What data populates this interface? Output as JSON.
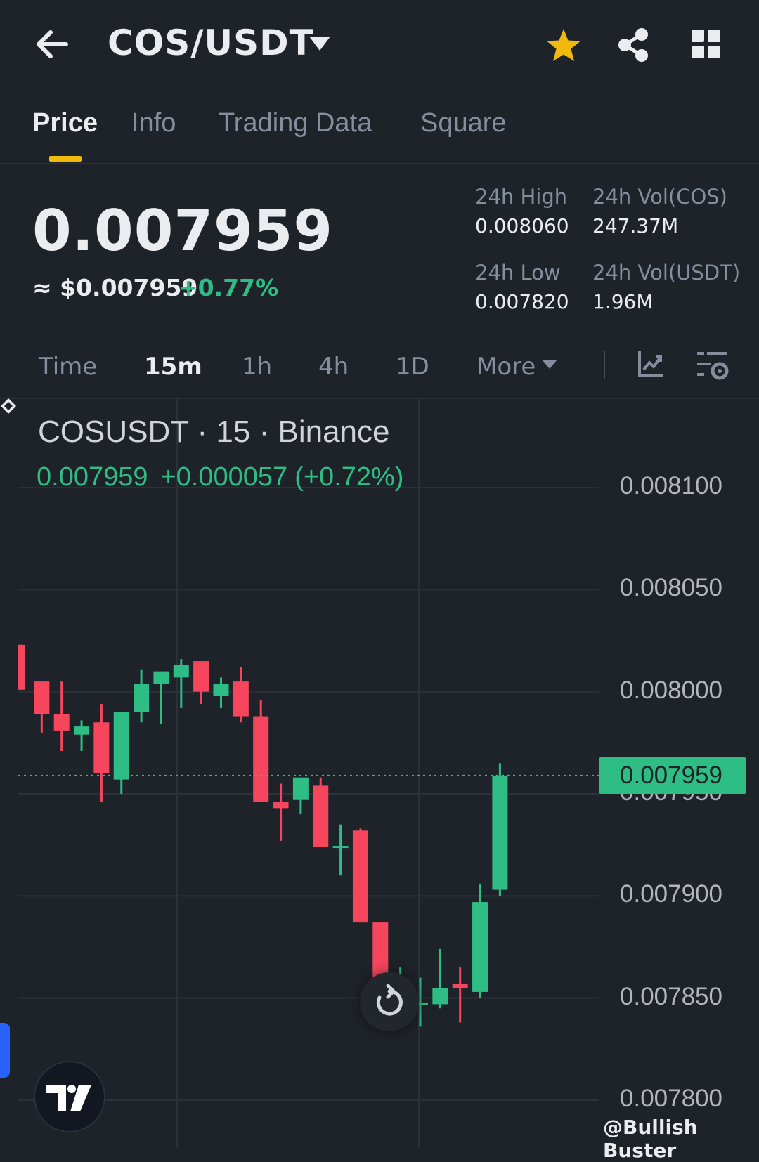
{
  "header": {
    "pair": "COS/USDT",
    "icons": [
      "back-arrow-icon",
      "chevron-down-icon",
      "star-icon",
      "share-icon",
      "grid-icon"
    ],
    "favorite_color": "#f0b90b"
  },
  "tabs": [
    {
      "label": "Price",
      "active": true
    },
    {
      "label": "Info",
      "active": false
    },
    {
      "label": "Trading Data",
      "active": false
    },
    {
      "label": "Square",
      "active": false
    }
  ],
  "ticker": {
    "price": "0.007959",
    "fiat": "≈ $0.007959",
    "change": "+0.77%",
    "high_label": "24h High",
    "high": "0.008060",
    "low_label": "24h Low",
    "low": "0.007820",
    "vol_base_label": "24h Vol(COS)",
    "vol_base": "247.37M",
    "vol_quote_label": "24h Vol(USDT)",
    "vol_quote": "1.96M"
  },
  "intervals": [
    {
      "label": "Time",
      "active": false
    },
    {
      "label": "15m",
      "active": true
    },
    {
      "label": "1h",
      "active": false
    },
    {
      "label": "4h",
      "active": false
    },
    {
      "label": "1D",
      "active": false
    },
    {
      "label": "More",
      "active": false
    }
  ],
  "chart_data": {
    "type": "candlestick",
    "symbol_line": "COSUSDT · 15 · Binance",
    "last": "0.007959",
    "change_abs": "+0.000057",
    "change_pct": "(+0.72%)",
    "y_ticks": [
      "0.008100",
      "0.008050",
      "0.008000",
      "0.007950",
      "0.007900",
      "0.007850",
      "0.007800"
    ],
    "ylim": [
      0.0078,
      0.0081
    ],
    "current_price": 0.007959,
    "current_price_label": "0.007959",
    "up_color": "#2ebd85",
    "down_color": "#f6465d",
    "candles": [
      {
        "o": 0.008023,
        "h": 0.008023,
        "l": 0.008001,
        "c": 0.008001
      },
      {
        "o": 0.008005,
        "h": 0.008005,
        "l": 0.00798,
        "c": 0.007989
      },
      {
        "o": 0.007989,
        "h": 0.008005,
        "l": 0.007971,
        "c": 0.007981
      },
      {
        "o": 0.007979,
        "h": 0.007986,
        "l": 0.007971,
        "c": 0.007983
      },
      {
        "o": 0.007985,
        "h": 0.007994,
        "l": 0.007946,
        "c": 0.00796
      },
      {
        "o": 0.007957,
        "h": 0.007989,
        "l": 0.00795,
        "c": 0.00799
      },
      {
        "o": 0.00799,
        "h": 0.008011,
        "l": 0.007985,
        "c": 0.008004
      },
      {
        "o": 0.008004,
        "h": 0.008007,
        "l": 0.007984,
        "c": 0.00801
      },
      {
        "o": 0.008007,
        "h": 0.008016,
        "l": 0.007992,
        "c": 0.008013
      },
      {
        "o": 0.008015,
        "h": 0.008015,
        "l": 0.007994,
        "c": 0.008
      },
      {
        "o": 0.007998,
        "h": 0.008007,
        "l": 0.007992,
        "c": 0.008004
      },
      {
        "o": 0.008005,
        "h": 0.008012,
        "l": 0.007985,
        "c": 0.007988
      },
      {
        "o": 0.007988,
        "h": 0.007996,
        "l": 0.007946,
        "c": 0.007946
      },
      {
        "o": 0.007946,
        "h": 0.007955,
        "l": 0.007927,
        "c": 0.007943
      },
      {
        "o": 0.007947,
        "h": 0.007957,
        "l": 0.00794,
        "c": 0.007958
      },
      {
        "o": 0.007954,
        "h": 0.007958,
        "l": 0.00793,
        "c": 0.007924
      },
      {
        "o": 0.007924,
        "h": 0.007935,
        "l": 0.00791,
        "c": 0.007924
      },
      {
        "o": 0.007932,
        "h": 0.007933,
        "l": 0.007887,
        "c": 0.007887
      },
      {
        "o": 0.007887,
        "h": 0.007887,
        "l": 0.007843,
        "c": 0.007847
      },
      {
        "o": 0.007844,
        "h": 0.007865,
        "l": 0.007842,
        "c": 0.007845
      },
      {
        "o": 0.007847,
        "h": 0.00786,
        "l": 0.007836,
        "c": 0.007847
      },
      {
        "o": 0.007847,
        "h": 0.007874,
        "l": 0.007845,
        "c": 0.007855
      },
      {
        "o": 0.007857,
        "h": 0.007865,
        "l": 0.007838,
        "c": 0.007855
      },
      {
        "o": 0.007853,
        "h": 0.007906,
        "l": 0.00785,
        "c": 0.007897
      },
      {
        "o": 0.007903,
        "h": 0.007965,
        "l": 0.0079,
        "c": 0.007959
      }
    ]
  },
  "watermark": "@Bullish Buster"
}
